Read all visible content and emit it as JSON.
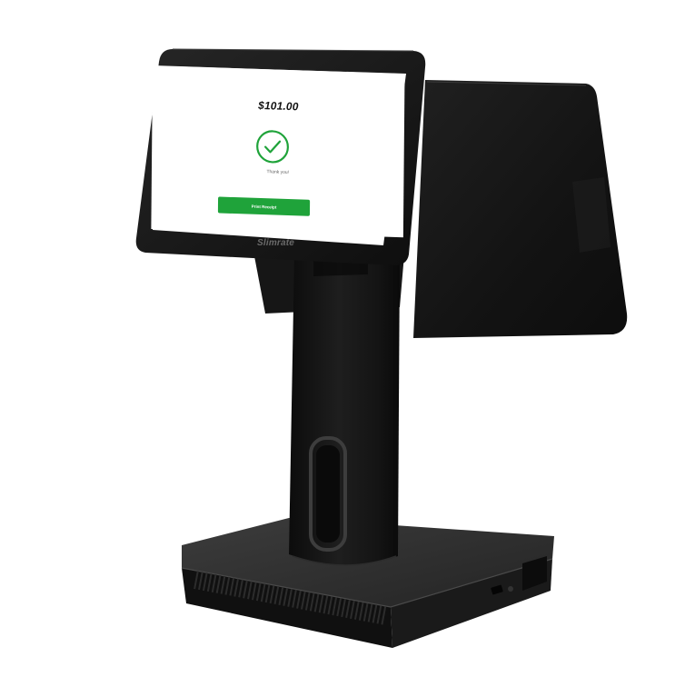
{
  "screen": {
    "amount": "$101.00",
    "check_icon": "checkmark-circle-icon",
    "thank_you": "Thank you!",
    "print_button_label": "Print Receipt",
    "accent_color": "#1fa33a"
  },
  "device": {
    "brand": "Slimrate"
  }
}
